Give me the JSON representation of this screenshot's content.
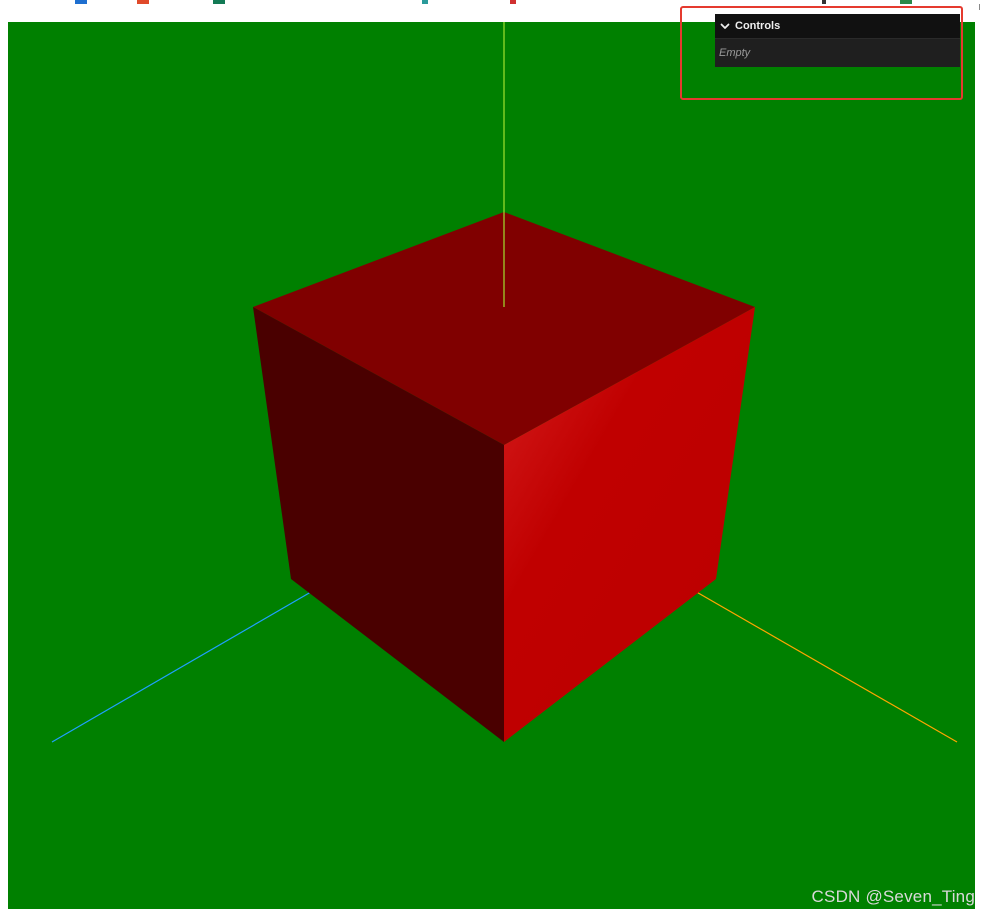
{
  "colors": {
    "canvas_background": "#008000",
    "cube_top": "#800000",
    "cube_left": "#4a0000",
    "cube_right": "#c00000",
    "axis_y": "#a0e030",
    "axis_x": "#ffa500",
    "axis_z": "#20a0ff",
    "highlight": "#e53a2f",
    "gui_header": "#111111",
    "gui_body": "#1f1f1f"
  },
  "gui": {
    "title": "Controls",
    "title_icon": "chevron-down-icon",
    "empty_text": "Empty"
  },
  "scene": {
    "object": "cube",
    "axes_helper": [
      "x",
      "y",
      "z"
    ]
  },
  "watermark": {
    "text": "CSDN @Seven_Ting"
  }
}
